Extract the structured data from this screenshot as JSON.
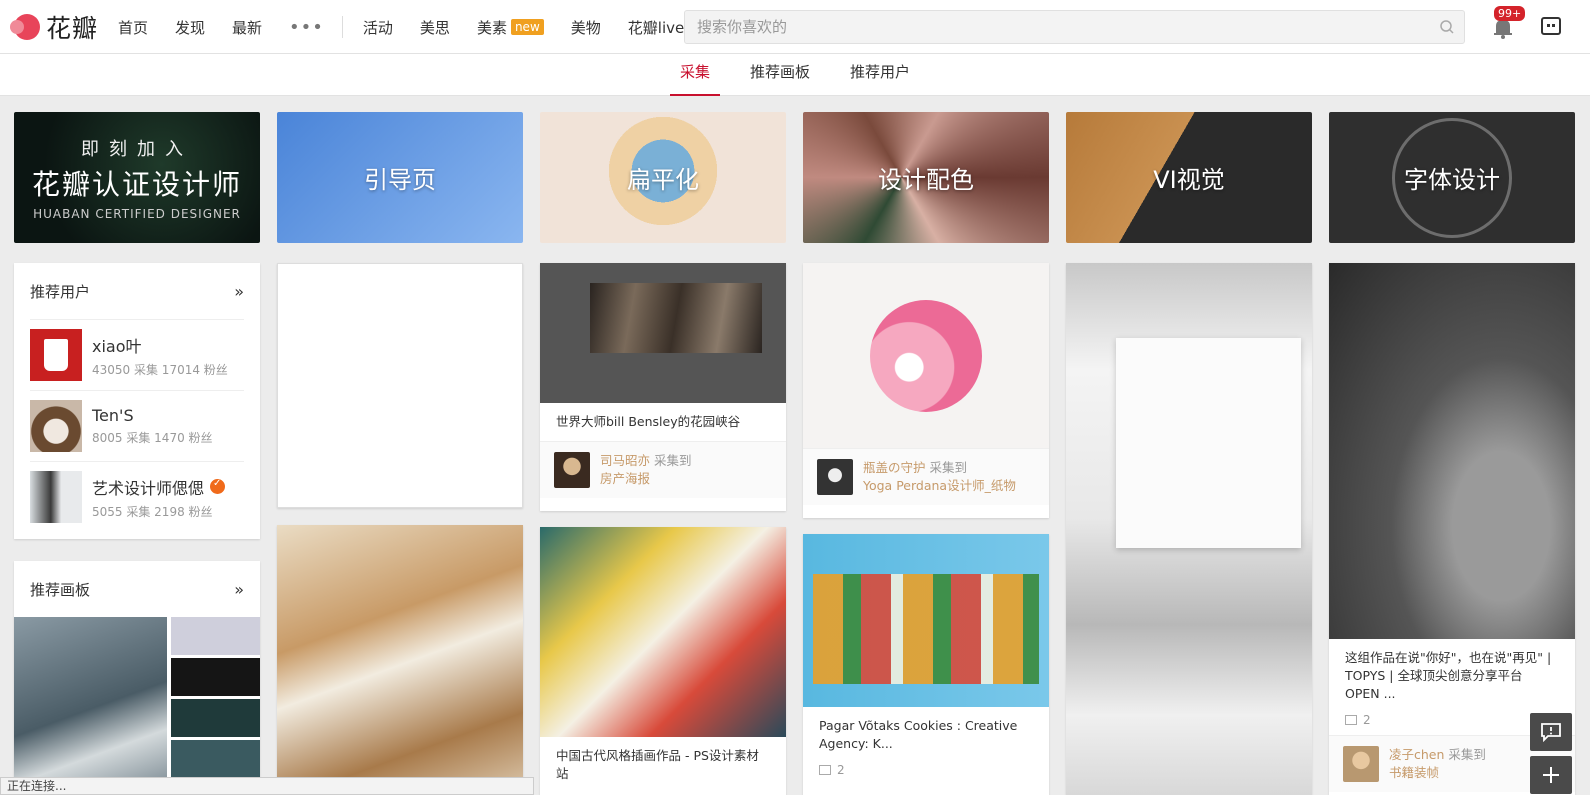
{
  "header": {
    "logo_text": "花瓣",
    "nav": [
      "首页",
      "发现",
      "最新"
    ],
    "more": "•••",
    "nav2": [
      "活动",
      "美思",
      "美素",
      "美物",
      "花瓣live"
    ],
    "new_badge": "new",
    "search_placeholder": "搜索你喜欢的",
    "notification_count": "99+"
  },
  "subtabs": [
    "采集",
    "推荐画板",
    "推荐用户"
  ],
  "banners": {
    "b1_line1": "即刻加入",
    "b1_line2": "花瓣认证设计师",
    "b1_line3": "HUABAN CERTIFIED DESIGNER",
    "labels": [
      "引导页",
      "扁平化",
      "设计配色",
      "VI视觉",
      "字体设计"
    ]
  },
  "rec_users": {
    "title": "推荐用户",
    "more": "»",
    "users": [
      {
        "name": "xiao叶",
        "stats": "43050 采集 17014 粉丝"
      },
      {
        "name": "Ten'S",
        "stats": "8005 采集 1470 粉丝"
      },
      {
        "name": "艺术设计师偲偲",
        "stats": "5055 采集 2198 粉丝"
      }
    ]
  },
  "rec_boards": {
    "title": "推荐画板",
    "more": "»"
  },
  "pins": {
    "p1": {
      "title": "世界大师bill Bensley的花园峡谷",
      "user": "司马昭亦",
      "action": "采集到",
      "board": "房产海报"
    },
    "p2": {
      "user": "瓶盖の守护",
      "action": "采集到",
      "board": "Yoga Perdana设计师_纸物"
    },
    "p3": {
      "title": "中国古代风格插画作品 - PS设计素材站"
    },
    "p4": {
      "title": "Pagar Võtaks Cookies : Creative Agency: K...",
      "repins": "2"
    },
    "p5": {
      "title": "这组作品在说\"你好\"，也在说\"再见\" | TOPYS | 全球顶尖创意分享平台 OPEN ...",
      "repins": "2",
      "user": "凌子chen",
      "action": "采集到",
      "board": "书籍装帧"
    }
  },
  "status_text": "正在连接...",
  "colors": {
    "accent": "#c8102e",
    "user_link": "#c69a6a",
    "badge": "#f0a020"
  }
}
